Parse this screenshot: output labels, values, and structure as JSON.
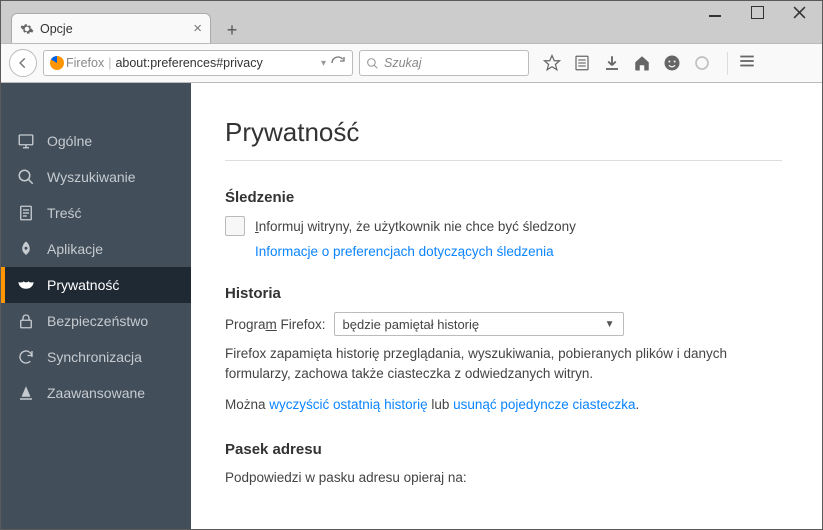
{
  "window": {
    "tab_title": "Opcje",
    "url_identity": "Firefox",
    "url": "about:preferences#privacy",
    "search_placeholder": "Szukaj"
  },
  "sidebar": {
    "items": [
      {
        "label": "Ogólne"
      },
      {
        "label": "Wyszukiwanie"
      },
      {
        "label": "Treść"
      },
      {
        "label": "Aplikacje"
      },
      {
        "label": "Prywatność"
      },
      {
        "label": "Bezpieczeństwo"
      },
      {
        "label": "Synchronizacja"
      },
      {
        "label": "Zaawansowane"
      }
    ]
  },
  "main": {
    "title": "Prywatność",
    "tracking": {
      "heading": "Śledzenie",
      "checkbox_prefix": "I",
      "checkbox_rest": "nformuj witryny, że użytkownik nie chce być śledzony",
      "link": "Informacje o preferencjach dotyczących śledzenia"
    },
    "history": {
      "heading": "Historia",
      "program_prefix": "Progra",
      "program_underline": "m",
      "program_suffix": " Firefox:",
      "select_value": "będzie pamiętał historię",
      "desc": "Firefox zapamięta historię przeglądania, wyszukiwania, pobieranych plików i danych formularzy, zachowa także ciasteczka z odwiedzanych witryn.",
      "can_prefix": "Można ",
      "link1": "wyczyścić ostatnią historię",
      "mid": " lub ",
      "link2": "usunąć pojedyncze ciasteczka",
      "suffix": "."
    },
    "locbar": {
      "heading": "Pasek adresu",
      "desc": "Podpowiedzi w pasku adresu opieraj na:"
    }
  }
}
